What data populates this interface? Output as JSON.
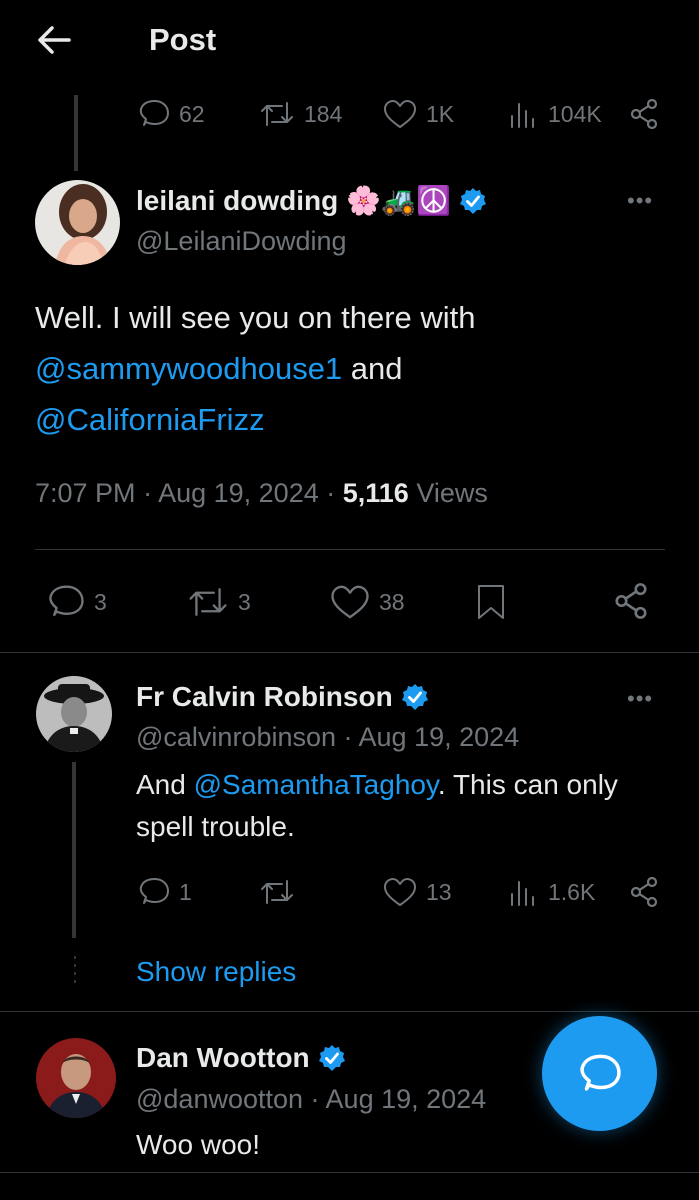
{
  "header": {
    "title": "Post"
  },
  "parent_actions": {
    "replies": "62",
    "reposts": "184",
    "likes": "1K",
    "views": "104K"
  },
  "main_post": {
    "display_name": "leilani dowding",
    "emojis": "🌸🚜☮️",
    "handle": "@LeilaniDowding",
    "text_1": "Well. I will see you on there with",
    "mention_1": "@sammywoodhouse1",
    "text_2": " and",
    "mention_2": "@CaliforniaFrizz",
    "time": "7:07 PM",
    "date": "Aug 19, 2024",
    "views_count": "5,116",
    "views_label": "Views",
    "replies": "3",
    "reposts": "3",
    "likes": "38"
  },
  "reply_1": {
    "display_name": "Fr Calvin Robinson",
    "handle": "@calvinrobinson",
    "date": "Aug 19, 2024",
    "text_1": "And ",
    "mention": "@SamanthaTaghoy",
    "text_2": ". This can only spell trouble.",
    "replies": "1",
    "likes": "13",
    "views": "1.6K",
    "show_replies": "Show replies"
  },
  "reply_2": {
    "display_name": "Dan Wootton",
    "handle": "@danwootton",
    "date": "Aug 19, 2024",
    "text": "Woo woo!"
  },
  "colors": {
    "accent": "#1d9bf0",
    "muted": "#71767b",
    "text": "#e7e9ea",
    "background": "#000000"
  },
  "icons": [
    "back-arrow-icon",
    "reply-icon",
    "repost-icon",
    "like-icon",
    "views-icon",
    "share-icon",
    "bookmark-icon",
    "verified-badge-icon",
    "more-icon",
    "compose-reply-icon"
  ]
}
